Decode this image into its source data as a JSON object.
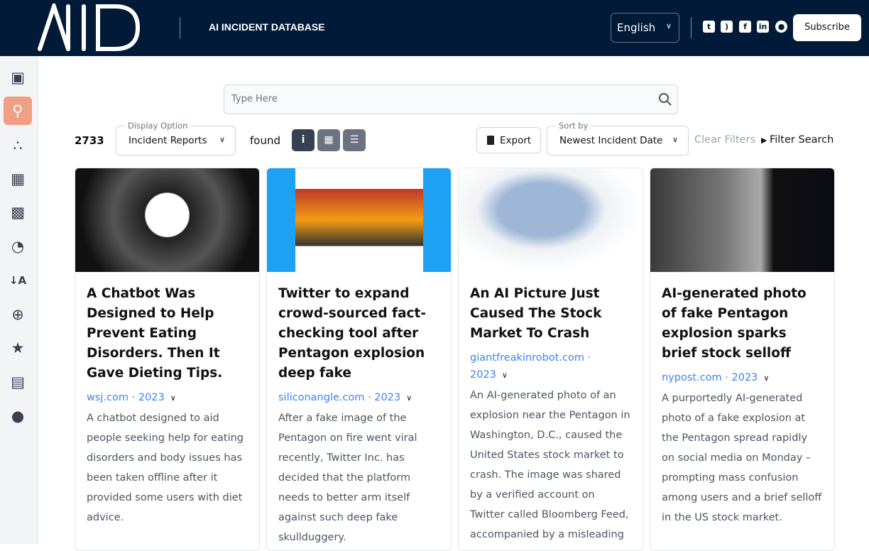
{
  "header": {
    "logo_text": "AIID",
    "title": "AI INCIDENT DATABASE",
    "language": "English",
    "subscribe": "Subscribe"
  },
  "sidebar": {
    "items": [
      "welcome",
      "discover",
      "spatial-view",
      "table-view",
      "entities",
      "taxonomies",
      "word-counts",
      "submit",
      "leaderboard",
      "blog",
      "account"
    ],
    "active": "discover"
  },
  "search": {
    "placeholder": "Type Here"
  },
  "toolbar": {
    "count": "2733",
    "display_label": "Display Option",
    "display_value": "Incident Reports",
    "found": "found",
    "view_icons": [
      "i",
      "▦",
      "☰"
    ],
    "export": "Export",
    "sort_label": "Sort by",
    "sort_value": "Newest Incident Date",
    "clear": "Clear Filters",
    "filter": "Filter Search"
  },
  "cards": [
    {
      "title": "A Chatbot Was Designed to Help Prevent Eating Disorders. Then It Gave Dieting Tips.",
      "source": "wsj.com · 2023",
      "text": "A chatbot designed to aid people seeking help for eating disorders and body issues has been taken offline after it provided some users with diet advice."
    },
    {
      "title": "Twitter to expand crowd-sourced fact-checking tool after Pentagon explosion deep fake",
      "source": "siliconangle.com · 2023",
      "text": "After a fake image of the Pentagon on fire went viral recently, Twitter Inc. has decided that the platform needs to better arm itself against such deep fake skullduggery."
    },
    {
      "title": "An AI Picture Just Caused The Stock Market To Crash",
      "source": "giantfreakinrobot.com · 2023",
      "text": "An AI-generated photo of an explosion near the Pentagon in Washington, D.C., caused the United States stock market to crash. The image was shared by a verified account on Twitter called Bloomberg Feed, accompanied by a misleading"
    },
    {
      "title": "AI-generated photo of fake Pentagon explosion sparks brief stock selloff",
      "source": "nypost.com · 2023",
      "text": "A purportedly AI-generated photo of a fake explosion at the Pentagon spread rapidly on social media on Monday – prompting mass confusion among users and a brief selloff in the US stock market."
    }
  ]
}
